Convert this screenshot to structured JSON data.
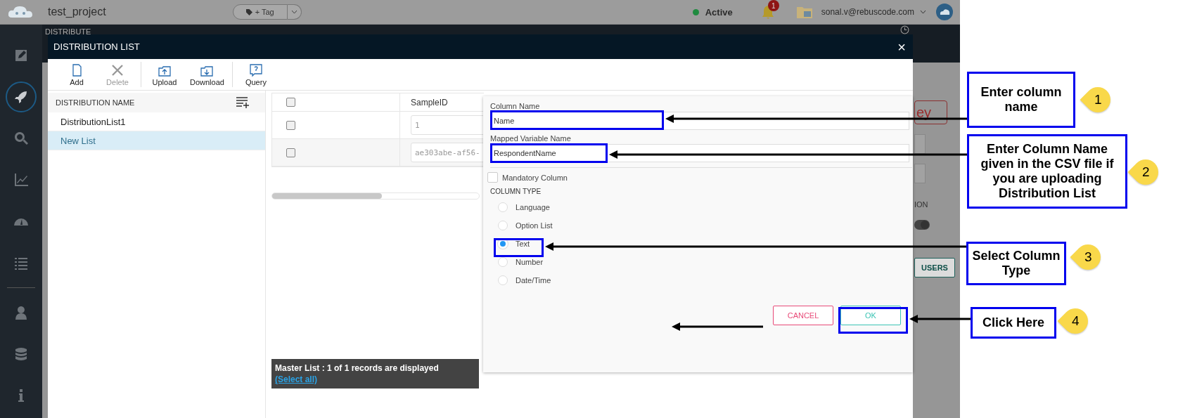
{
  "topbar": {
    "project": "test_project",
    "tag_button": "+ Tag",
    "status": "Active",
    "notifications": "1",
    "user": "sonal.v@rebuscode.com"
  },
  "nav": [
    {
      "kind": "edit",
      "selected": false
    },
    {
      "kind": "rocket",
      "selected": true
    },
    {
      "kind": "search",
      "selected": false
    },
    {
      "kind": "chart",
      "selected": false
    },
    {
      "kind": "gauge",
      "selected": false
    },
    {
      "kind": "list",
      "selected": false
    },
    {
      "kind": "user",
      "selected": false
    },
    {
      "kind": "database",
      "selected": false
    },
    {
      "kind": "info",
      "selected": false
    }
  ],
  "section_title": "DISTRIBUTE",
  "background": {
    "button": "ey",
    "label": "ION",
    "toggle_on": true,
    "users_button": "USERS"
  },
  "dialog": {
    "title": "DISTRIBUTION LIST",
    "close": "×",
    "toolbar": [
      {
        "kind": "add",
        "label": "Add",
        "disabled": false
      },
      {
        "kind": "delete",
        "label": "Delete",
        "disabled": true
      },
      {
        "kind": "upload",
        "label": "Upload",
        "disabled": false
      },
      {
        "kind": "download",
        "label": "Download",
        "disabled": false
      },
      {
        "kind": "query",
        "label": "Query",
        "disabled": false
      }
    ],
    "list_header": "DISTRIBUTION NAME",
    "lists": [
      {
        "name": "DistributionList1",
        "selected": false
      },
      {
        "name": "New List",
        "selected": true
      }
    ],
    "grid": {
      "column": "SampleID",
      "header_checked": false,
      "rows": [
        {
          "checked": false,
          "value": "1"
        },
        {
          "checked": false,
          "value": "ae303abe-af56-"
        }
      ]
    },
    "footer": {
      "text": "Master List : 1 of 1 records are displayed",
      "link": "(Select all)"
    },
    "form": {
      "column_name_label": "Column Name",
      "column_name": "Name",
      "mapped_label": "Mapped Variable Name",
      "mapped_value": "RespondentName",
      "mandatory": {
        "label": "Mandatory Column",
        "checked": false
      },
      "type_label": "COLUMN TYPE",
      "types": [
        {
          "label": "Language",
          "selected": false
        },
        {
          "label": "Option List",
          "selected": false
        },
        {
          "label": "Text",
          "selected": true
        },
        {
          "label": "Number",
          "selected": false
        },
        {
          "label": "Date/Time",
          "selected": false
        }
      ],
      "cancel": "CANCEL",
      "ok": "OK"
    }
  },
  "annotations": [
    {
      "number": "1",
      "text": "Enter column name"
    },
    {
      "number": "2",
      "text": "Enter Column Name given in the CSV file if you are uploading Distribution List"
    },
    {
      "number": "3",
      "text": "Select Column Type"
    },
    {
      "number": "4",
      "text": "Click Here"
    }
  ]
}
